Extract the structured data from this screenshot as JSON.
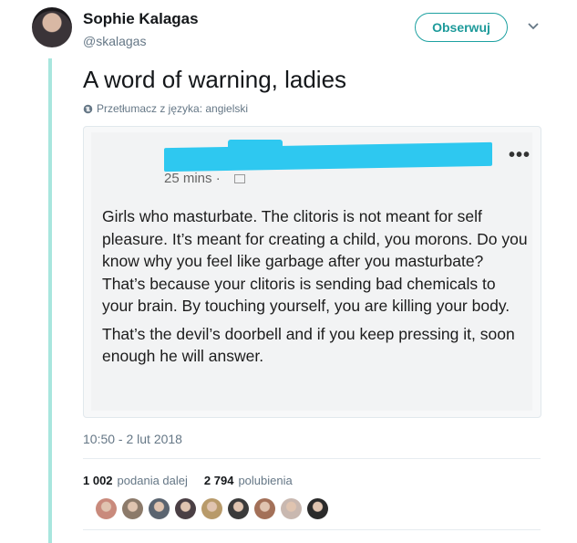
{
  "author": {
    "name": "Sophie Kalagas",
    "handle": "@skalagas"
  },
  "follow_button": "Obserwuj",
  "tweet": {
    "text": "A word of warning, ladies",
    "translate_label": "Przetłumacz z języka: angielski",
    "timestamp": "10:50 - 2 lut 2018"
  },
  "embedded_post": {
    "time_ago": "25 mins ·",
    "paragraphs": [
      "Girls who masturbate. The clitoris is not meant for self pleasure. It’s meant for creating a child, you morons. Do you know why you feel like garbage after you masturbate? That’s because your clitoris is sending bad chemicals to your brain. By touching yourself, you are killing your body.",
      "That’s the devil’s doorbell and if you keep pressing it, soon enough he will answer."
    ],
    "redaction_color": "#2ec8f0"
  },
  "stats": {
    "retweets_count": "1 002",
    "retweets_label": "podania dalej",
    "likes_count": "2 794",
    "likes_label": "polubienia"
  },
  "liker_avatar_colors": [
    "#c98a7c",
    "#8c7a6a",
    "#5a6470",
    "#4a3f44",
    "#b89a6a",
    "#3a3a3a",
    "#a37058",
    "#c9b8b0",
    "#2a2a2a"
  ],
  "colors": {
    "accent": "#1d9a9a",
    "thread_line": "#a8e6de",
    "secondary_text": "#657786"
  }
}
